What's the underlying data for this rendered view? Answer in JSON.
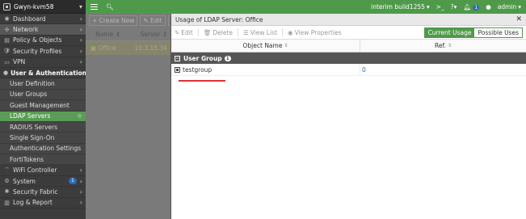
{
  "sidebar": {
    "device_name": "Gwyn-kvm58",
    "items": [
      {
        "label": "Dashboard",
        "icon": "dashboard-icon"
      },
      {
        "label": "Network",
        "icon": "network-icon"
      },
      {
        "label": "Policy & Objects",
        "icon": "policy-icon"
      },
      {
        "label": "Security Profiles",
        "icon": "security-profiles-icon"
      },
      {
        "label": "VPN",
        "icon": "vpn-icon"
      },
      {
        "label": "User & Authentication",
        "icon": "user-icon"
      }
    ],
    "sub_items": [
      {
        "label": "User Definition"
      },
      {
        "label": "User Groups"
      },
      {
        "label": "Guest Management"
      },
      {
        "label": "LDAP Servers"
      },
      {
        "label": "RADIUS Servers"
      },
      {
        "label": "Single Sign-On"
      },
      {
        "label": "Authentication Settings"
      },
      {
        "label": "FortiTokens"
      }
    ],
    "bottom_items": [
      {
        "label": "WiFi Controller",
        "icon": "wifi-icon"
      },
      {
        "label": "System",
        "icon": "gear-icon",
        "badge": "1"
      },
      {
        "label": "Security Fabric",
        "icon": "fabric-icon"
      },
      {
        "label": "Log & Report",
        "icon": "report-icon"
      }
    ]
  },
  "topbar": {
    "build": "interim build1255",
    "notif_count": "1",
    "user": "admin"
  },
  "background": {
    "create_new": "+ Create New",
    "edit": "Edit",
    "col_name": "Name",
    "col_server": "Server",
    "row_name": "Office",
    "row_server": "10.3.15.34"
  },
  "panel": {
    "title": "Usage of LDAP Server: Office",
    "tools": {
      "edit": "Edit",
      "delete": "Delete",
      "view_list": "View List",
      "view_properties": "View Properties"
    },
    "toggle": {
      "current": "Current Usage",
      "possible": "Possible Uses"
    },
    "columns": {
      "object_name": "Object Name",
      "ref": "Ref."
    },
    "group": {
      "label": "User Group",
      "count": "1"
    },
    "rows": [
      {
        "name": "testgroup",
        "ref": "0"
      }
    ]
  }
}
